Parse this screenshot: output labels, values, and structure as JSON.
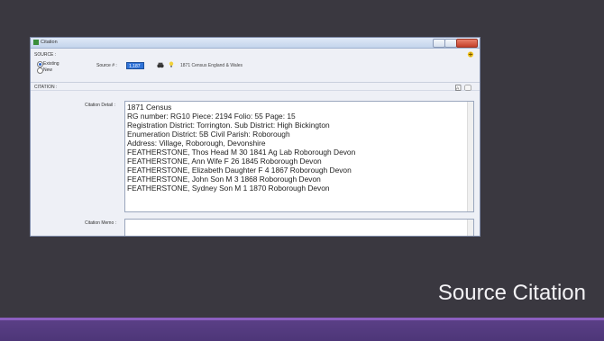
{
  "slide": {
    "title": "Source Citation"
  },
  "window": {
    "title": "Citation",
    "source_label": "SOURCE :",
    "radio_existing": "Existing",
    "radio_new": "New",
    "source_num_label": "Source # :",
    "source_num_value": "1,187",
    "source_title": "1871 Census England & Wales",
    "citation_label": "CITATION :",
    "citation_detail_label": "Citation Detail :",
    "citation_memo_label": "Citation Memo :",
    "detail_lines": [
      "1871 Census",
      "RG number: RG10 Piece: 2194  Folio: 55 Page: 15",
      "Registration District: Torrington. Sub District: High Bickington",
      "Enumeration District: 5B Civil Parish: Roborough",
      "Address: Village, Roborough, Devonshire",
      "FEATHERSTONE, Thos Head M 30 1841 Ag Lab Roborough Devon",
      "FEATHERSTONE, Ann Wife F 26 1845 Roborough Devon",
      "FEATHERSTONE, Elizabeth Daughter F 4 1867 Roborough Devon",
      "FEATHERSTONE, John Son M 3 1868 Roborough Devon",
      "FEATHERSTONE, Sydney Son M 1 1870 Roborough Devon"
    ]
  },
  "colors": {
    "background": "#3a3840",
    "accent_bar": "#5a3f86",
    "accent_line": "#8b5fc0"
  }
}
